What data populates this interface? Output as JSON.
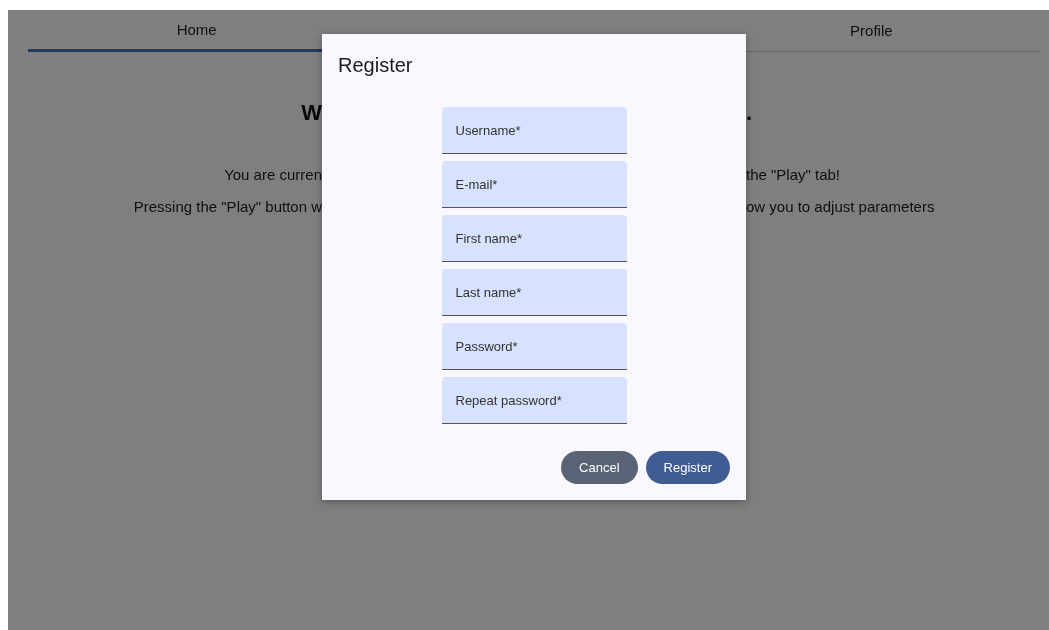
{
  "tabs": [
    {
      "label": "Home",
      "selected": true
    },
    {
      "label": "Profile",
      "selected": false
    }
  ],
  "page": {
    "heading": {
      "left": "W",
      "right": "."
    },
    "paragraphs": [
      {
        "left": "You are curren",
        "right": "the \"Play\" tab!"
      },
      {
        "left": "Pressing the \"Play\" button w",
        "right": "ow you to adjust parameters"
      }
    ]
  },
  "dialog": {
    "title": "Register",
    "fields": [
      {
        "placeholder": "Username*"
      },
      {
        "placeholder": "E-mail*"
      },
      {
        "placeholder": "First name*"
      },
      {
        "placeholder": "Last name*"
      },
      {
        "placeholder": "Password*"
      },
      {
        "placeholder": "Repeat password*"
      }
    ],
    "buttons": [
      {
        "label": "Cancel",
        "kind": "secondary"
      },
      {
        "label": "Register",
        "kind": "primary"
      }
    ]
  }
}
